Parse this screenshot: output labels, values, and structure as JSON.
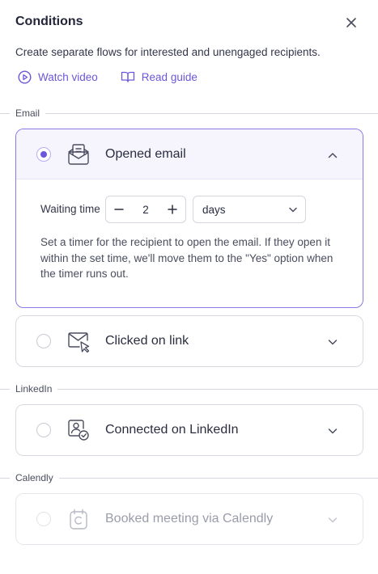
{
  "header": {
    "title": "Conditions",
    "description": "Create separate flows for interested and unengaged recipients."
  },
  "links": {
    "watch_video": "Watch video",
    "read_guide": "Read guide"
  },
  "sections": {
    "email": "Email",
    "linkedin": "LinkedIn",
    "calendly": "Calendly"
  },
  "conditions": {
    "opened_email": {
      "title": "Opened email",
      "selected": true,
      "expanded": true,
      "waiting_time_label": "Waiting time",
      "waiting_time_value": "2",
      "waiting_time_unit": "days",
      "description": "Set a timer for the recipient to open the email. If they open it within the set time, we'll move them to the \"Yes\" option when the timer runs out."
    },
    "clicked_link": {
      "title": "Clicked on link",
      "selected": false
    },
    "connected_linkedin": {
      "title": "Connected on LinkedIn",
      "selected": false
    },
    "booked_meeting": {
      "title": "Booked meeting via Calendly",
      "selected": false,
      "disabled": true
    }
  },
  "colors": {
    "accent": "#6b57d9",
    "accent_border": "#8b7ae6",
    "expanded_header_bg": "#f6f5fe",
    "text": "#23263a"
  },
  "icons": {
    "close": "close-icon",
    "watch_video": "play-circle-icon",
    "read_guide": "book-open-icon",
    "opened_email": "envelope-open-icon",
    "clicked_link": "envelope-cursor-icon",
    "connected_linkedin": "profile-check-icon",
    "booked_meeting": "calendar-icon"
  }
}
